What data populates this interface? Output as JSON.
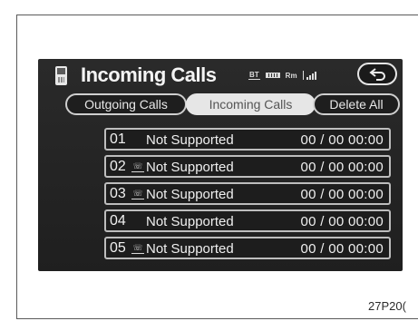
{
  "header": {
    "title": "Incoming Calls",
    "status": {
      "bluetooth": "BT",
      "roaming": "Rm"
    }
  },
  "tabs": [
    {
      "label": "Outgoing Calls",
      "active": false
    },
    {
      "label": "Incoming Calls",
      "active": true
    },
    {
      "label": "Delete All",
      "active": false
    }
  ],
  "calls": [
    {
      "index": "01",
      "name": "Not Supported",
      "time": "00 / 00 00:00",
      "pay_phone_icon": false
    },
    {
      "index": "02",
      "name": "Not Supported",
      "time": "00 / 00 00:00",
      "pay_phone_icon": true
    },
    {
      "index": "03",
      "name": "Not Supported",
      "time": "00 / 00 00:00",
      "pay_phone_icon": true
    },
    {
      "index": "04",
      "name": "Not Supported",
      "time": "00 / 00 00:00",
      "pay_phone_icon": false
    },
    {
      "index": "05",
      "name": "Not Supported",
      "time": "00 / 00 00:00",
      "pay_phone_icon": true
    }
  ],
  "caption": "27P20(",
  "colors": {
    "screen_bg": "#232323",
    "button_border": "#cfcfcf",
    "active_tab": "#e6e6e6"
  },
  "icons": {
    "title": "phone-handset-icon",
    "back": "back-arrow-icon",
    "pay_phone": "pay-phone-icon"
  }
}
